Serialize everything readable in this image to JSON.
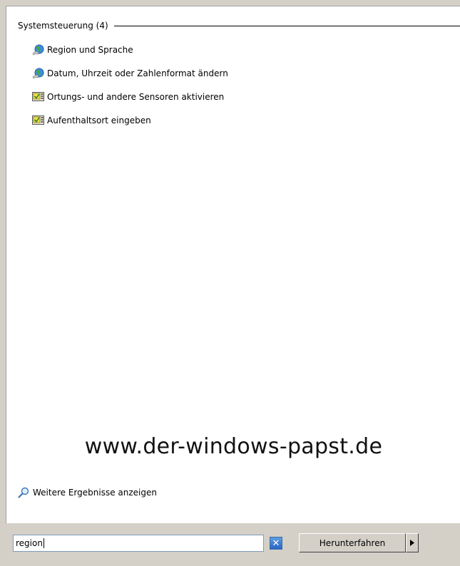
{
  "results": {
    "group_title": "Systemsteuerung (4)",
    "items": [
      {
        "label": "Region und Sprache",
        "icon": "globe-icon"
      },
      {
        "label": "Datum, Uhrzeit oder Zahlenformat ändern",
        "icon": "globe-icon"
      },
      {
        "label": "Ortungs- und andere Sensoren aktivieren",
        "icon": "control-panel-icon"
      },
      {
        "label": "Aufenthaltsort eingeben",
        "icon": "control-panel-icon"
      }
    ],
    "watermark": "www.der-windows-papst.de",
    "more_results_label": "Weitere Ergebnisse anzeigen"
  },
  "search": {
    "value": "region"
  },
  "shutdown": {
    "label": "Herunterfahren"
  },
  "colors": {
    "pane_background": "#ffffff",
    "window_background": "#d4d0c8",
    "search_border": "#7f9db9",
    "clear_button": "#3a78d4"
  }
}
